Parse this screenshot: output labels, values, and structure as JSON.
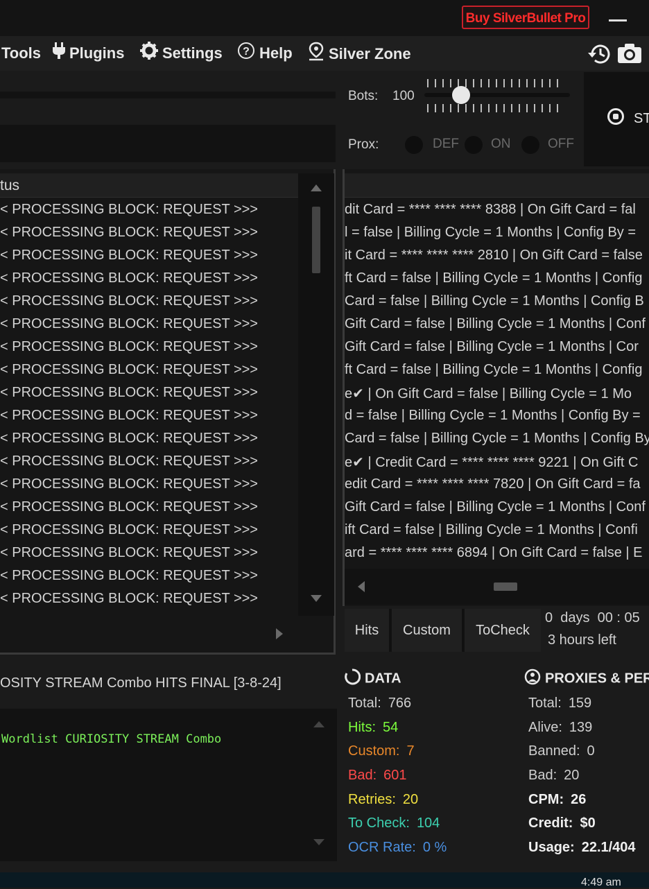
{
  "titlebar": {
    "buy_label": "Buy SilverBullet Pro"
  },
  "menu": {
    "tools": "Tools",
    "plugins": "Plugins",
    "settings": "Settings",
    "help": "Help",
    "silver_zone": "Silver Zone"
  },
  "runner": {
    "bots_label": "Bots:",
    "bots_value": "100",
    "bots_slider_value": 100,
    "prox_label": "Prox:",
    "prox_options": [
      "DEF",
      "ON",
      "OFF"
    ],
    "start_label": "ST"
  },
  "log": {
    "header": "tus",
    "rows": [
      "< PROCESSING BLOCK: REQUEST >>>",
      "< PROCESSING BLOCK: REQUEST >>>",
      "< PROCESSING BLOCK: REQUEST >>>",
      "< PROCESSING BLOCK: REQUEST >>>",
      "< PROCESSING BLOCK: REQUEST >>>",
      "< PROCESSING BLOCK: REQUEST >>>",
      "< PROCESSING BLOCK: REQUEST >>>",
      "< PROCESSING BLOCK: REQUEST >>>",
      "< PROCESSING BLOCK: REQUEST >>>",
      "< PROCESSING BLOCK: REQUEST >>>",
      "< PROCESSING BLOCK: REQUEST >>>",
      "< PROCESSING BLOCK: REQUEST >>>",
      "< PROCESSING BLOCK: REQUEST >>>",
      "< PROCESSING BLOCK: REQUEST >>>",
      "< PROCESSING BLOCK: REQUEST >>>",
      "< PROCESSING BLOCK: REQUEST >>>",
      "< PROCESSING BLOCK: REQUEST >>>",
      "< PROCESSING BLOCK: REQUEST >>>"
    ]
  },
  "results": {
    "rows": [
      "dit Card = **** **** **** 8388 | On Gift Card = fal",
      "l = false | Billing Cycle = 1 Months | Config By =",
      "it Card = **** **** **** 2810 | On Gift Card = false",
      "ft Card = false | Billing Cycle = 1 Months | Config",
      " Card = false | Billing Cycle = 1 Months | Config B",
      "Gift Card = false | Billing Cycle = 1 Months | Conf",
      " Gift Card = false | Billing Cycle = 1 Months | Cor",
      "ft Card = false | Billing Cycle = 1 Months | Config",
      "e✔ | On Gift Card = false | Billing Cycle = 1 Mo",
      "d = false | Billing Cycle = 1 Months | Config By =",
      "Card = false | Billing Cycle = 1 Months | Config By",
      "e✔ | Credit Card = **** **** **** 9221 | On Gift C",
      "edit Card = **** **** **** 7820 | On Gift Card = fa",
      "Gift Card = false | Billing Cycle = 1 Months | Conf",
      "ift Card = false | Billing Cycle = 1 Months | Confi",
      "ard = **** **** **** 6894 | On Gift Card = false | E"
    ]
  },
  "tabs": {
    "hits": "Hits",
    "custom": "Custom",
    "tocheck": "ToCheck"
  },
  "timer": {
    "elapsed": "0  days  00 : 05",
    "remaining": "3 hours left"
  },
  "config": {
    "name": "OSITY STREAM Combo HITS FINAL [3-8-24]",
    "console_line": "Wordlist CURIOSITY STREAM Combo"
  },
  "data_stats": {
    "title": "DATA",
    "total_label": "Total:",
    "total": "766",
    "hits_label": "Hits:",
    "hits": "54",
    "custom_label": "Custom:",
    "custom": "7",
    "bad_label": "Bad:",
    "bad": "601",
    "retries_label": "Retries:",
    "retries": "20",
    "tocheck_label": "To Check:",
    "tocheck": "104",
    "ocr_label": "OCR Rate:",
    "ocr": "0 %"
  },
  "proxy_stats": {
    "title": "PROXIES & PER",
    "total_label": "Total:",
    "total": "159",
    "alive_label": "Alive:",
    "alive": "139",
    "banned_label": "Banned:",
    "banned": "0",
    "bad_label": "Bad:",
    "bad": "20",
    "cpm_label": "CPM:",
    "cpm": "26",
    "credit_label": "Credit:",
    "credit": "$0",
    "usage_label": "Usage:",
    "usage": "22.1/404"
  },
  "taskbar": {
    "clock": "4:49 am"
  },
  "colors": {
    "hits": "#7CFC3C",
    "custom": "#E8872A",
    "bad": "#FF4A4A",
    "retries": "#F0E040",
    "tocheck": "#3CD0B0",
    "ocr": "#4A8FE0",
    "buy": "#FF2B2B"
  }
}
